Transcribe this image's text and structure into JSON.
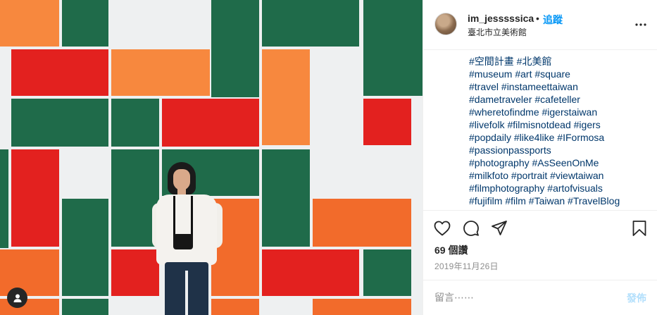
{
  "post": {
    "username": "im_jesssssica",
    "separator": "•",
    "follow_label": "追蹤",
    "location": "臺北市立美術館",
    "caption_lines": [
      "#空間計畫 #北美館",
      "#museum #art #square",
      "#travel #instameettaiwan",
      "#dametraveler #cafeteller",
      "#wheretofindme #igerstaiwan",
      "#livefolk #filmisnotdead #igers",
      "#popdaily #like4like #IFormosa",
      "#passionpassports",
      "#photography #AsSeenOnMe",
      "#milkfoto #portrait #viewtaiwan",
      "#filmphotography #artofvisuals",
      "#fujifilm #film #Taiwan #TravelBlog"
    ],
    "likes_label": "69 個讚",
    "date": "2019年11月26日"
  },
  "comment": {
    "placeholder": "留言⋯⋯",
    "post_label": "發佈"
  },
  "icons": {
    "more": "more-options-icon",
    "like": "heart-icon",
    "comment": "comment-icon",
    "share": "share-icon",
    "save": "bookmark-icon",
    "user_tag": "user-tag-icon"
  },
  "colors": {
    "link": "#0095f6",
    "hashtag": "#00376b",
    "post_disabled": "#b2dffc",
    "muted": "#8e8e8e",
    "wall_green": "#1f6b4a",
    "wall_red": "#e3211f",
    "wall_orange": "#f26b2b"
  }
}
